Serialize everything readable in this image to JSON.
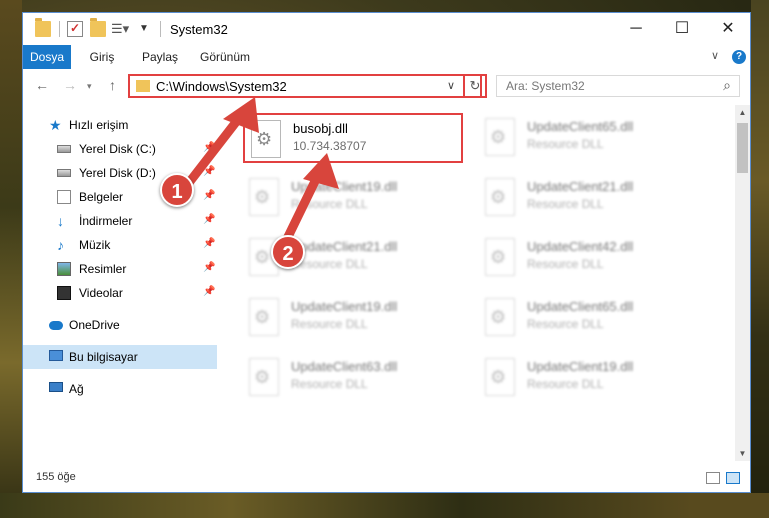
{
  "window": {
    "title": "System32"
  },
  "ribbon": {
    "tabs": [
      {
        "label": "Dosya"
      },
      {
        "label": "Giriş"
      },
      {
        "label": "Paylaş"
      },
      {
        "label": "Görünüm"
      }
    ]
  },
  "nav": {
    "address": "C:\\Windows\\System32",
    "search_placeholder": "Ara: System32"
  },
  "sidebar": {
    "items": [
      {
        "label": "Hızlı erişim",
        "icon": "star-icon"
      },
      {
        "label": "Yerel Disk (C:)",
        "icon": "disk-icon",
        "pinned": true
      },
      {
        "label": "Yerel Disk (D:)",
        "icon": "disk-icon",
        "pinned": true
      },
      {
        "label": "Belgeler",
        "icon": "document-icon",
        "pinned": true
      },
      {
        "label": "İndirmeler",
        "icon": "download-icon",
        "pinned": true
      },
      {
        "label": "Müzik",
        "icon": "music-icon",
        "pinned": true
      },
      {
        "label": "Resimler",
        "icon": "pictures-icon",
        "pinned": true
      },
      {
        "label": "Videolar",
        "icon": "video-icon",
        "pinned": true
      },
      {
        "label": "OneDrive",
        "icon": "cloud-icon"
      },
      {
        "label": "Bu bilgisayar",
        "icon": "computer-icon",
        "selected": true
      },
      {
        "label": "Ağ",
        "icon": "network-icon"
      }
    ]
  },
  "files": [
    {
      "name": "busobj.dll",
      "sub": "10.734.38707",
      "highlighted": true
    },
    {
      "name": "UpdateClient65.dll",
      "sub": "Resource DLL"
    },
    {
      "name": "UpdateClient19.dll",
      "sub": "Resource DLL"
    },
    {
      "name": "UpdateClient21.dll",
      "sub": "Resource DLL"
    },
    {
      "name": "UpdateClient21.dll",
      "sub": "Resource DLL"
    },
    {
      "name": "UpdateClient42.dll",
      "sub": "Resource DLL"
    },
    {
      "name": "UpdateClient19.dll",
      "sub": "Resource DLL"
    },
    {
      "name": "UpdateClient65.dll",
      "sub": "Resource DLL"
    },
    {
      "name": "UpdateClient63.dll",
      "sub": "Resource DLL"
    },
    {
      "name": "UpdateClient19.dll",
      "sub": "Resource DLL"
    }
  ],
  "status": {
    "item_count": "155 öğe"
  },
  "annotations": {
    "step1": "1",
    "step2": "2"
  },
  "colors": {
    "accent": "#1979ca",
    "highlight": "#e24040",
    "badge": "#d8453c"
  }
}
